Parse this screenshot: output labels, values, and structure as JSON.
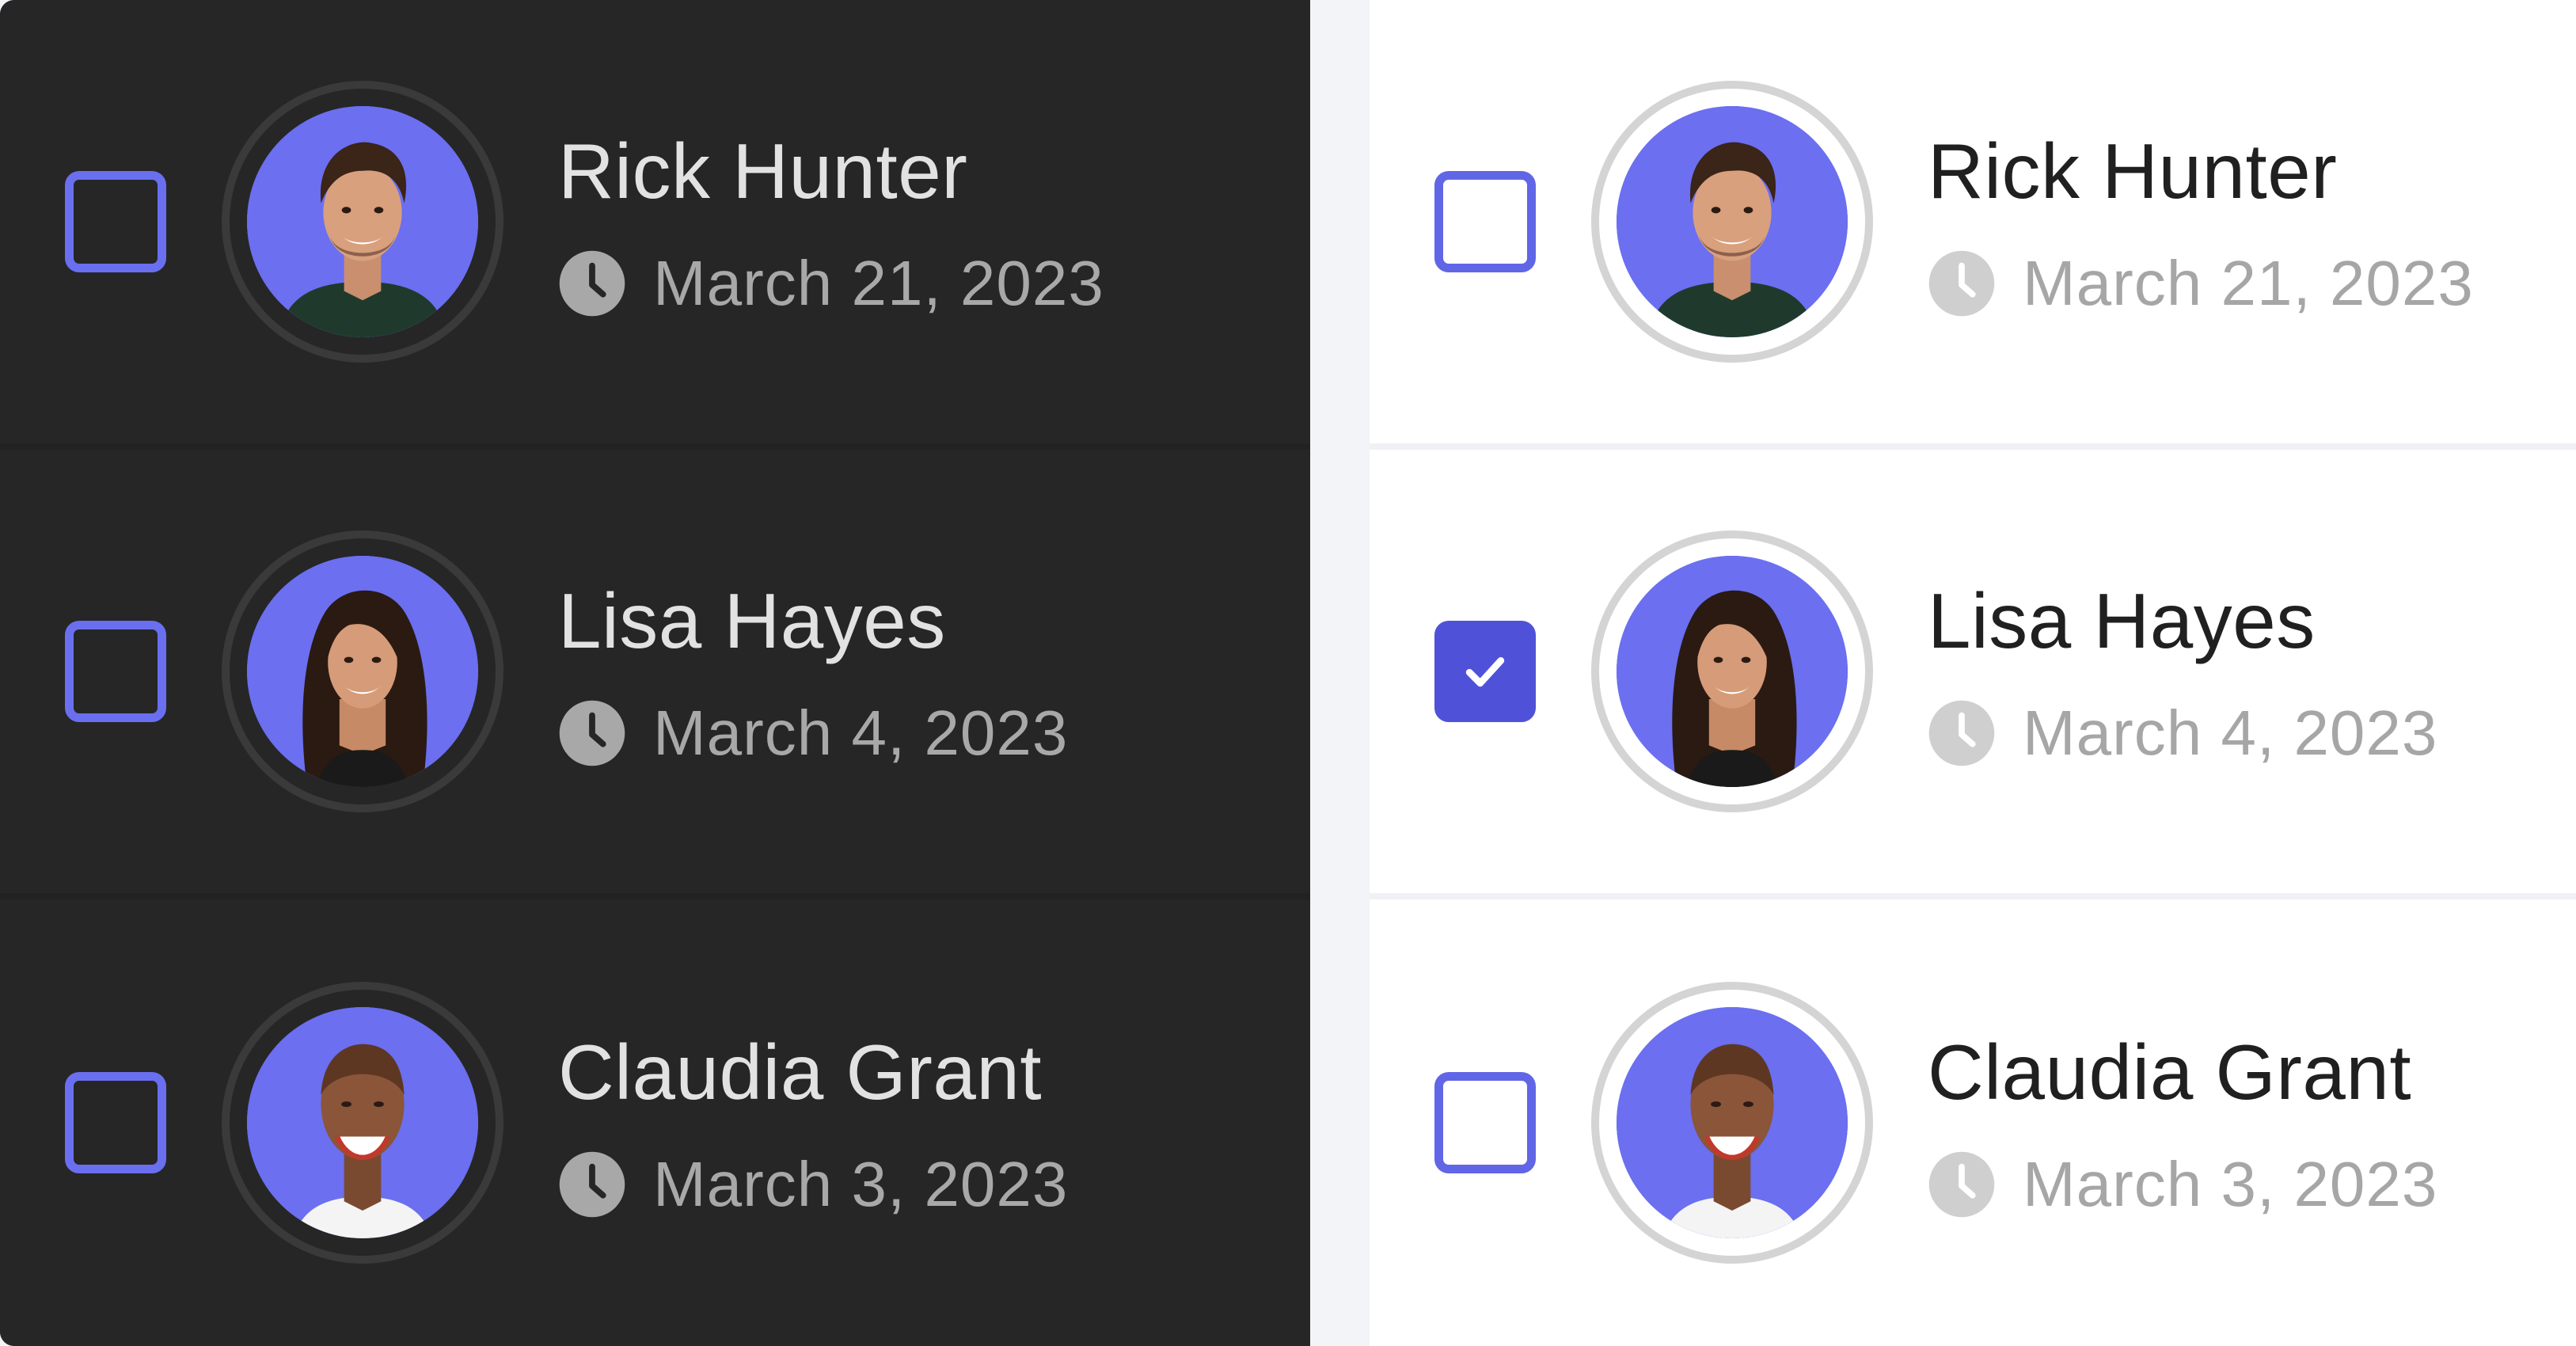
{
  "theme": {
    "accent": "#6166e6",
    "checked_fill": "#4f52d9",
    "avatar_bg": "#6b6ff0",
    "dark_panel_bg": "#262626",
    "light_panel_bg": "#ffffff"
  },
  "dark_panel": {
    "rows": [
      {
        "name": "Rick Hunter",
        "date": "March 21, 2023",
        "checked": false,
        "avatar": "man-portrait"
      },
      {
        "name": "Lisa Hayes",
        "date": "March 4, 2023",
        "checked": false,
        "avatar": "woman-long-hair-portrait"
      },
      {
        "name": "Claudia Grant",
        "date": "March 3, 2023",
        "checked": false,
        "avatar": "woman-shaved-head-portrait"
      }
    ]
  },
  "light_panel": {
    "rows": [
      {
        "name": "Rick Hunter",
        "date": "March 21, 2023",
        "checked": false,
        "avatar": "man-portrait"
      },
      {
        "name": "Lisa Hayes",
        "date": "March 4, 2023",
        "checked": true,
        "avatar": "woman-long-hair-portrait"
      },
      {
        "name": "Claudia Grant",
        "date": "March 3, 2023",
        "checked": false,
        "avatar": "woman-shaved-head-portrait"
      }
    ]
  },
  "icons": {
    "clock": "clock-icon",
    "check": "checkmark-icon"
  }
}
